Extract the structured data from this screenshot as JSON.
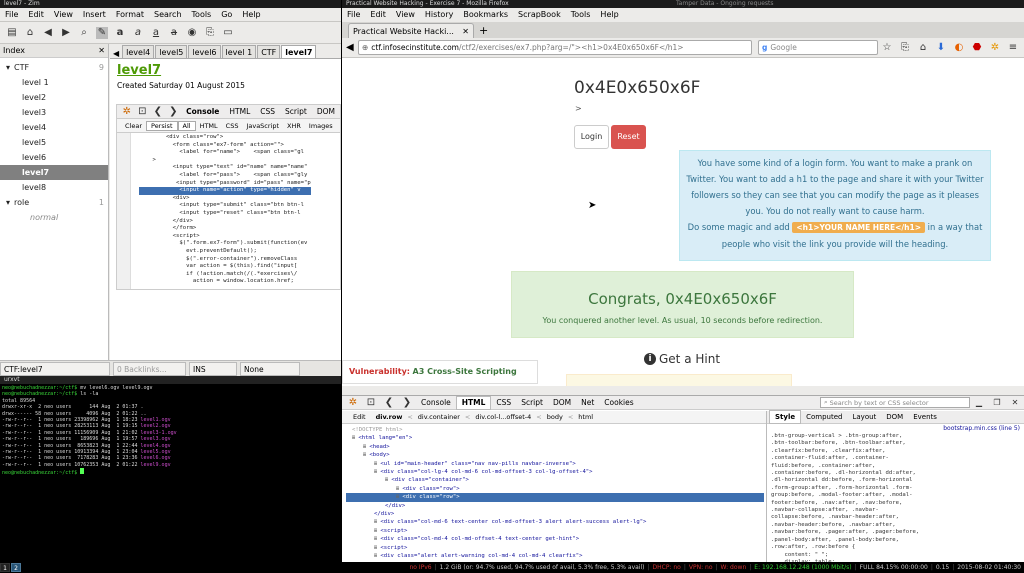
{
  "zim": {
    "title": "level7 - Zim",
    "menu": [
      "File",
      "Edit",
      "View",
      "Insert",
      "Format",
      "Search",
      "Tools",
      "Go",
      "Help"
    ],
    "index_label": "Index",
    "tree": [
      {
        "label": "CTF",
        "count": "9",
        "expanded": true,
        "level": 0
      },
      {
        "label": "level 1",
        "level": 1
      },
      {
        "label": "level2",
        "level": 1
      },
      {
        "label": "level3",
        "level": 1
      },
      {
        "label": "level4",
        "level": 1
      },
      {
        "label": "level5",
        "level": 1
      },
      {
        "label": "level6",
        "level": 1
      },
      {
        "label": "level7",
        "level": 1,
        "selected": true
      },
      {
        "label": "level8",
        "level": 1
      },
      {
        "label": "role",
        "count": "1",
        "expanded": true,
        "level": 0
      },
      {
        "label": "normal",
        "level": 2
      }
    ],
    "tabs": [
      "level4",
      "level5",
      "level6",
      "level 1",
      "CTF",
      "level7"
    ],
    "page_title": "level7",
    "created": "Created Saturday 01 August 2015",
    "firebug_tabs": [
      "Console",
      "HTML",
      "CSS",
      "Script",
      "DOM"
    ],
    "console_filters": [
      "Clear",
      "Persist",
      "All",
      "HTML",
      "CSS",
      "JavaScript",
      "XHR",
      "Images"
    ],
    "code_lines": [
      "        <div class=\"row\">",
      "          <form class=\"ex7-form\" action=\"\">",
      "            <label for=\"name\">    <span class=\"gl",
      "    >",
      "",
      "          <input type=\"text\" id=\"name\" name=\"name\"",
      "            <label for=\"pass\">    <span class=\"gly",
      "",
      "           <input type=\"password\" id=\"pass\" name=\"p",
      "            <input name=\"action\" type=\"hidden\" v",
      "          <div>",
      "            <input type=\"submit\" class=\"btn btn-l",
      "            <input type=\"reset\" class=\"btn btn-l",
      "          </div>",
      "          </form>",
      "          <script>",
      "            $(\".form.ex7-form\").submit(function(ev",
      "              evt.preventDefault();",
      "              $(\".error-container\").removeClass",
      "              var action = $(this).find(\"input[",
      "              if (!action.match(/(.*exercises\\/",
      "                action = window.location.href;"
    ],
    "status": [
      "CTF:level7",
      "0 Backlinks...",
      "INS",
      "None"
    ]
  },
  "terminal": {
    "title": "urxvt",
    "lines": [
      {
        "p": "neo@nebuchadnezzar:~/ctf$ ",
        "c": "mv level6.ogv level9.ogv"
      },
      {
        "p": "neo@nebuchadnezzar:~/ctf$ ",
        "c": "ls -la"
      },
      {
        "p": "",
        "c": "total 89564"
      },
      {
        "p": "",
        "c": "drwxr-xr-x  2 neo users      144 Aug  2 01:37 ."
      },
      {
        "p": "",
        "c": "drwx------ 58 neo users     4096 Aug  2 01:22 .."
      },
      {
        "p": "",
        "c": "-rw-r--r--  1 neo users 23398962 Aug  1 18:23 ",
        "f": "level1.ogv"
      },
      {
        "p": "",
        "c": "-rw-r--r--  1 neo users 28253113 Aug  1 19:15 ",
        "f": "level2.ogv"
      },
      {
        "p": "",
        "c": "-rw-r--r--  1 neo users 11156909 Aug  1 21:02 ",
        "f": "level3-1.ogv"
      },
      {
        "p": "",
        "c": "-rw-r--r--  1 neo users   189696 Aug  1 19:57 ",
        "f": "level3.ogv"
      },
      {
        "p": "",
        "c": "-rw-r--r--  1 neo users  8653823 Aug  1 22:44 ",
        "f": "level4.ogv"
      },
      {
        "p": "",
        "c": "-rw-r--r--  1 neo users 10913394 Aug  1 23:04 ",
        "f": "level5.ogv"
      },
      {
        "p": "",
        "c": "-rw-r--r--  1 neo users  7178283 Aug  1 23:36 ",
        "f": "level6.ogv"
      },
      {
        "p": "",
        "c": "-rw-r--r--  1 neo users 10762353 Aug  2 01:22 ",
        "f": "level9.ogv"
      },
      {
        "p": "neo@nebuchadnezzar:~/ctf$ ",
        "c": ""
      }
    ]
  },
  "firefox": {
    "title": "Practical Website Hacking - Exercise 7 - Mozilla Firefox",
    "tamper": "Tamper Data - Ongoing requests",
    "menu": [
      "File",
      "Edit",
      "View",
      "History",
      "Bookmarks",
      "ScrapBook",
      "Tools",
      "Help"
    ],
    "tab_title": "Practical Website Hacki...",
    "url_host": "ctf.infosecinstitute.com",
    "url_path": "/ctf2/exercises/ex7.php?arg=/\"><h1>0x4E0x650x6F</h1>",
    "search_placeholder": "Google",
    "page": {
      "h1": "0x4E0x650x6F",
      "gt": ">",
      "login": "Login",
      "reset": "Reset",
      "info1": "You have some kind of a login form. You want to make a prank on Twitter. You want to add a h1 to the page and share it with your Twitter followers so they can see that you can modify the page as it pleases you. You do not really want to cause harm.",
      "info2a": "Do some magic and add",
      "info_badge": "<h1>YOUR NAME HERE</h1>",
      "info2b": "in a way that people who visit the link you provide will the heading.",
      "congrats": "Congrats, 0x4E0x650x6F",
      "congrats_sub": "You conquered another level. As usual, 10 seconds before redirection.",
      "hint": "Get a Hint",
      "vuln_label": "Vulnerability:",
      "vuln_value": "A3 Cross-Site Scripting (XSS)"
    },
    "devtools": {
      "tabs": [
        "Console",
        "HTML",
        "CSS",
        "Script",
        "DOM",
        "Net",
        "Cookies"
      ],
      "search_placeholder": "Search by text or CSS selector",
      "breadcrumb": [
        "Edit",
        "div.row",
        "div.container",
        "div.col-l...offset-4",
        "body",
        "html"
      ],
      "side_tabs": [
        "Style",
        "Computed",
        "Layout",
        "DOM",
        "Events"
      ],
      "css_file": "bootstrap.min.css (line 5)",
      "tree": [
        {
          "t": "<!DOCTYPE html>",
          "i": 0,
          "c": true
        },
        {
          "t": "<html lang=\"en\">",
          "i": 0
        },
        {
          "t": "<head>",
          "i": 1
        },
        {
          "t": "<body>",
          "i": 1
        },
        {
          "t": "<ul id=\"main-header\" class=\"nav nav-pills navbar-inverse\">",
          "i": 2
        },
        {
          "t": "<div class=\"col-lg-4 col-md-6 col-md-offset-3 col-lg-offset-4\">",
          "i": 2
        },
        {
          "t": "<div class=\"container\">",
          "i": 3
        },
        {
          "t": "<div class=\"row\">",
          "i": 4
        },
        {
          "t": "<div class=\"row\">",
          "i": 4,
          "sel": true
        },
        {
          "t": "</div>",
          "i": 3
        },
        {
          "t": "</div>",
          "i": 2
        },
        {
          "t": "<div class=\"col-md-6 text-center col-md-offset-3 alert alert-success alert-lg\">",
          "i": 2
        },
        {
          "t": "<script>",
          "i": 2
        },
        {
          "t": "<div class=\"col-md-4 col-md-offset-4 text-center get-hint\">",
          "i": 2
        },
        {
          "t": "<script>",
          "i": 2
        },
        {
          "t": "<div class=\"alert alert-warning col-md-4 col-md-4 clearfix\">",
          "i": 2
        },
        {
          "t": "<script>",
          "i": 2
        }
      ],
      "css_lines": [
        ".btn-group-vertical > .btn-group:after,",
        ".btn-toolbar:before, .btn-toolbar:after,",
        ".clearfix:before, .clearfix:after,",
        ".container-fluid:after, .container-",
        "fluid:before, .container:after,",
        ".container:before, .dl-horizontal dd:after,",
        ".dl-horizontal dd:before, .form-horizontal",
        ".form-group:after, .form-horizontal .form-",
        "group:before, .modal-footer:after, .modal-",
        "footer:before, .nav:after, .nav:before,",
        ".navbar-collapse:after, .navbar-",
        "collapse:before, .navbar-header:after,",
        ".navbar-header:before, .navbar:after,",
        ".navbar:before, .pager:after, .pager:before,",
        ".panel-body:after, .panel-body:before,",
        ".row:after, .row:before {",
        "    content: \" \";",
        "    display: table;"
      ]
    }
  },
  "statusbar": {
    "workspaces": [
      "1",
      "2"
    ],
    "items": [
      "no IPv6",
      "1.2 GiB (or: 94.7% used, 94.7% used of avail, 5.3% free, 5.3% avail)",
      "DHCP: no",
      "VPN: no",
      "W: down",
      "E: 192.168.12.248 (1000 Mbit/s)",
      "FULL 84.15% 00:00:00",
      "0.15",
      "2015-08-02 01:40:30"
    ]
  }
}
